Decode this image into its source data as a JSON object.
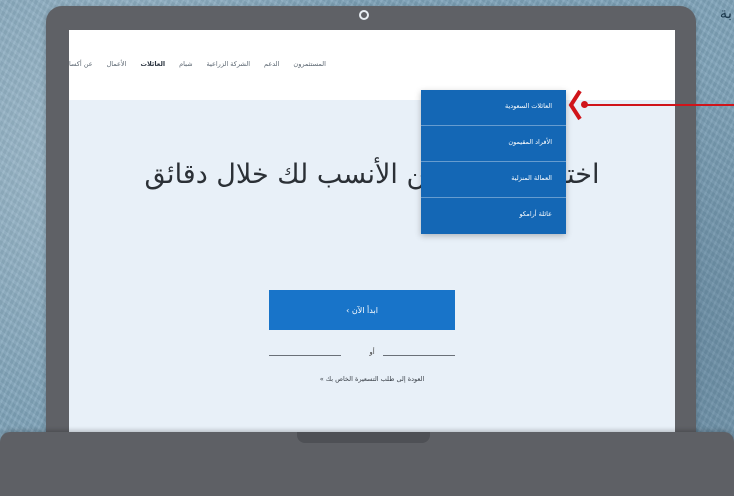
{
  "corner_text": "بة",
  "nav": {
    "items": [
      "عن أكسا",
      "الأعمال",
      "العائلات",
      "شبام",
      "الشركة الزراعية",
      "الدعم",
      "المستثمرون"
    ],
    "active_index": 2
  },
  "dropdown": {
    "items": [
      "العائلات السعودية",
      "الأفراد المقيمون",
      "العمالة المنزلية",
      "عائلة أرامكو"
    ]
  },
  "hero": {
    "headline": "اختر خطة التأمين الأنسب لك خلال دقائق",
    "cta_label": "ابدأ الآن ›",
    "or_text": "أو",
    "back_link": "العودة إلى طلب التسعيرة الخاص بك »"
  },
  "colors": {
    "accent": "#1874c9",
    "dropdown_bg": "#1467b5",
    "hero_bg": "#e8f0f8",
    "annotation": "#d0141a"
  }
}
